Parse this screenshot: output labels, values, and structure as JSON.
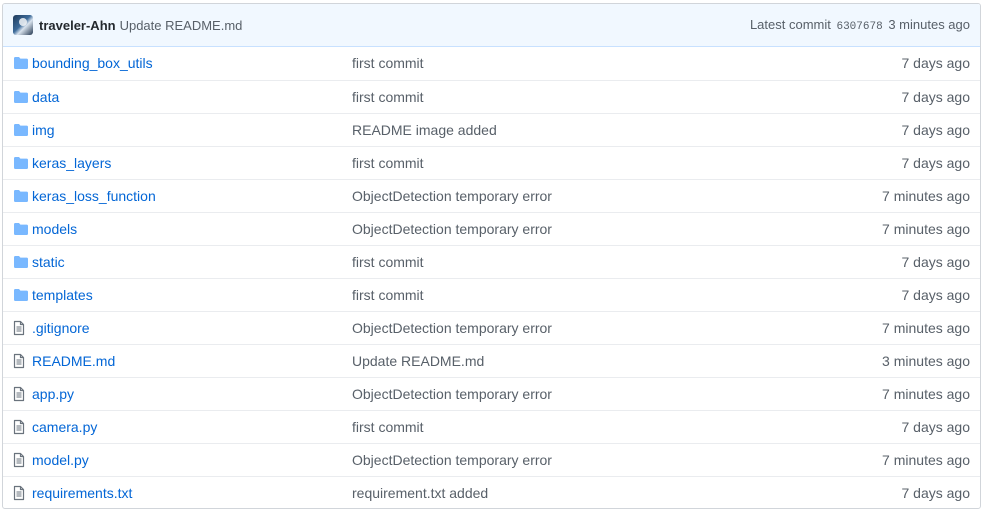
{
  "commit": {
    "author": "traveler-Ahn",
    "message": "Update README.md",
    "latest_label": "Latest commit",
    "sha": "6307678",
    "age": "3 minutes ago"
  },
  "colors": {
    "link": "#0366d6",
    "folder_icon": "#79b8ff",
    "file_icon": "#6a737d",
    "commit_bar_bg": "#f1f8ff"
  },
  "files": [
    {
      "type": "folder",
      "icon": "folder-icon",
      "name": "bounding_box_utils",
      "message": "first commit",
      "age": "7 days ago"
    },
    {
      "type": "folder",
      "icon": "folder-icon",
      "name": "data",
      "message": "first commit",
      "age": "7 days ago"
    },
    {
      "type": "folder",
      "icon": "folder-icon",
      "name": "img",
      "message": "README image added",
      "age": "7 days ago"
    },
    {
      "type": "folder",
      "icon": "folder-icon",
      "name": "keras_layers",
      "message": "first commit",
      "age": "7 days ago"
    },
    {
      "type": "folder",
      "icon": "folder-icon",
      "name": "keras_loss_function",
      "message": "ObjectDetection temporary error",
      "age": "7 minutes ago"
    },
    {
      "type": "folder",
      "icon": "folder-icon",
      "name": "models",
      "message": "ObjectDetection temporary error",
      "age": "7 minutes ago"
    },
    {
      "type": "folder",
      "icon": "folder-icon",
      "name": "static",
      "message": "first commit",
      "age": "7 days ago"
    },
    {
      "type": "folder",
      "icon": "folder-icon",
      "name": "templates",
      "message": "first commit",
      "age": "7 days ago"
    },
    {
      "type": "file",
      "icon": "file-icon",
      "name": ".gitignore",
      "message": "ObjectDetection temporary error",
      "age": "7 minutes ago"
    },
    {
      "type": "file",
      "icon": "file-icon",
      "name": "README.md",
      "message": "Update README.md",
      "age": "3 minutes ago"
    },
    {
      "type": "file",
      "icon": "file-icon",
      "name": "app.py",
      "message": "ObjectDetection temporary error",
      "age": "7 minutes ago"
    },
    {
      "type": "file",
      "icon": "file-icon",
      "name": "camera.py",
      "message": "first commit",
      "age": "7 days ago"
    },
    {
      "type": "file",
      "icon": "file-icon",
      "name": "model.py",
      "message": "ObjectDetection temporary error",
      "age": "7 minutes ago"
    },
    {
      "type": "file",
      "icon": "file-icon",
      "name": "requirements.txt",
      "message": "requirement.txt added",
      "age": "7 days ago"
    }
  ]
}
